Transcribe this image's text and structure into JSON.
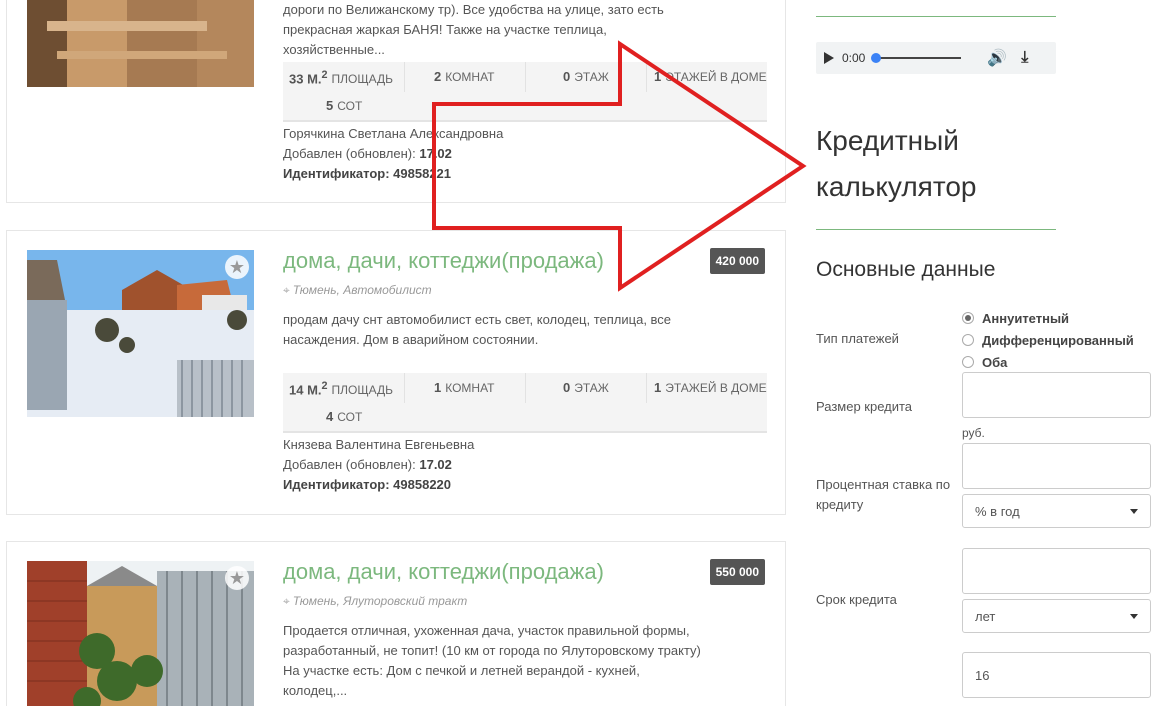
{
  "listings": [
    {
      "title": "",
      "price": "",
      "location": "",
      "description": "дороги по Велижанскому тр). Все удобства на улице, зато есть прекрасная жаркая БАНЯ! Также на участке теплица, хозяйственные...",
      "stats": {
        "area": "33 М.",
        "area_sup": "2",
        "area_label": "площадь",
        "rooms": "2",
        "rooms_label": "комнат",
        "floor": "0",
        "floor_label": "этаж",
        "floors": "1",
        "floors_label": "этажей в доме",
        "plot": "5",
        "plot_label": "сот"
      },
      "owner": "Горячкина Светлана Александровна",
      "added_label": "Добавлен (обновлен):",
      "added": "17.02",
      "id_label": "Идентификатор:",
      "id": "49858221"
    },
    {
      "title": "дома, дачи, коттеджи(продажа)",
      "price": "420 000",
      "location": "Тюмень, Автомобилист",
      "description": "продам дачу снт автомобилист есть свет, колодец, теплица, все насаждения. Дом в аварийном состоянии.",
      "stats": {
        "area": "14 М.",
        "area_sup": "2",
        "area_label": "площадь",
        "rooms": "1",
        "rooms_label": "комнат",
        "floor": "0",
        "floor_label": "этаж",
        "floors": "1",
        "floors_label": "этажей в доме",
        "plot": "4",
        "plot_label": "сот"
      },
      "owner": "Князева Валентина Евгеньевна",
      "added_label": "Добавлен (обновлен):",
      "added": "17.02",
      "id_label": "Идентификатор:",
      "id": "49858220"
    },
    {
      "title": "дома, дачи, коттеджи(продажа)",
      "price": "550 000",
      "location": "Тюмень, Ялуторовский тракт",
      "description": "Продается отличная, ухоженная дача, участок правильной формы, разработанный, не топит! (10 км от города по Ялуторовскому тракту) На участке есть: Дом с печкой и летней верандой - кухней, колодец,..."
    }
  ],
  "sidebar": {
    "audio": {
      "time": "0:00"
    },
    "calc_title": "Кредитный калькулятор",
    "section_title": "Основные данные",
    "payment_type_label": "Тип платежей",
    "payment_options": [
      "Аннуитетный",
      "Дифференцированный",
      "Оба"
    ],
    "loan_size_label": "Размер кредита",
    "loan_size_unit": "руб.",
    "rate_label": "Процентная ставка по кредиту",
    "rate_select": "% в год",
    "term_label": "Срок кредита",
    "term_select": "лет",
    "extra_input_value": "16"
  },
  "colors": {
    "accent_green": "#7cb87e",
    "price_bg": "#555555",
    "arrow_red": "#e02020"
  },
  "icons": {
    "star": "star-icon",
    "pin": "map-pin-icon",
    "play": "play-icon",
    "volume": "volume-icon",
    "download": "download-icon"
  }
}
